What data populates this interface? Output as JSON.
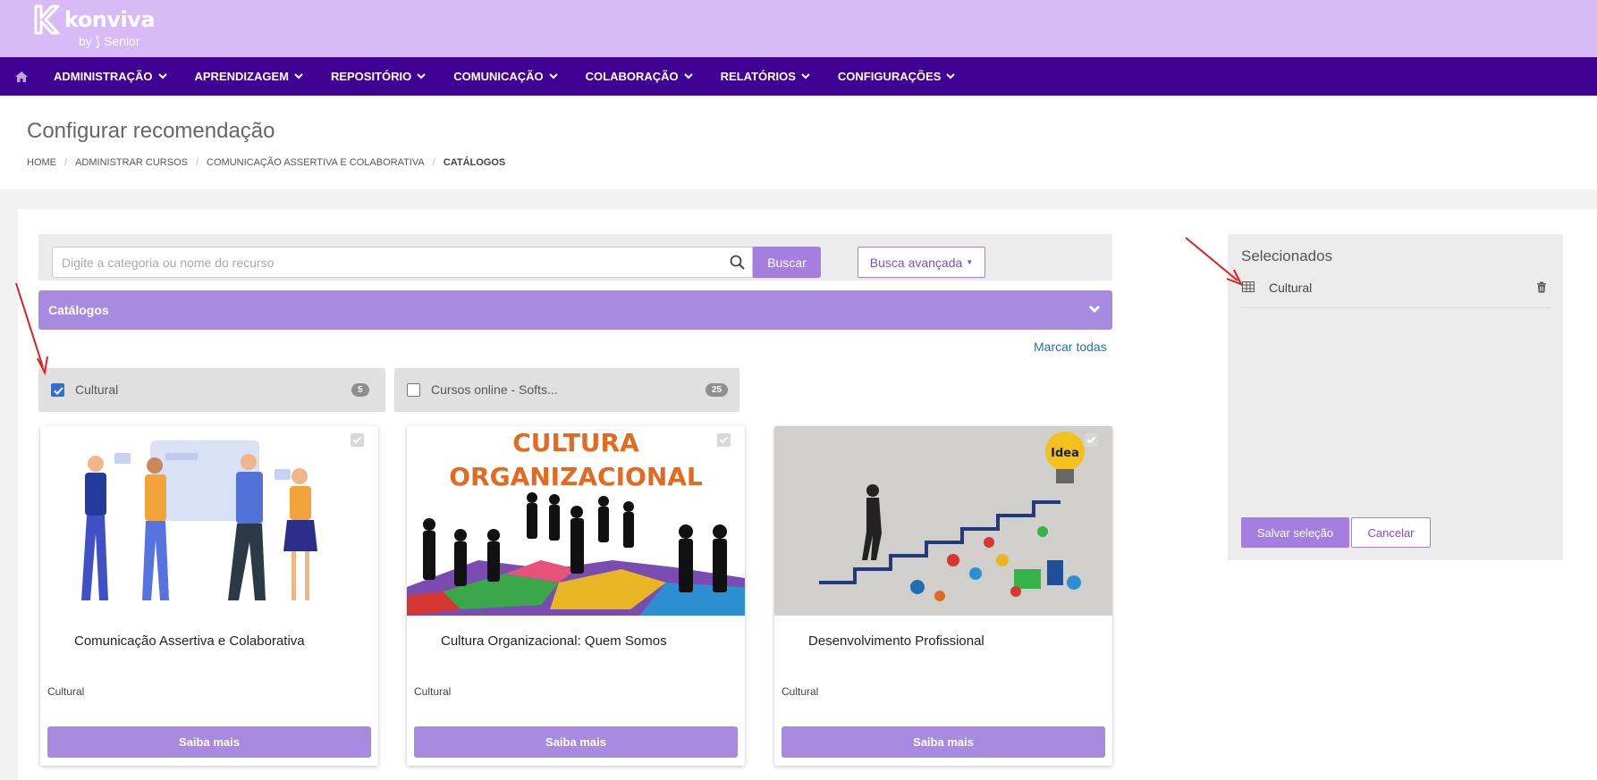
{
  "header": {
    "brand": "konviva",
    "brand_sub": "by ⟆ Senior"
  },
  "nav": {
    "items": [
      {
        "label": "ADMINISTRAÇÃO"
      },
      {
        "label": "APRENDIZAGEM"
      },
      {
        "label": "REPOSITÓRIO"
      },
      {
        "label": "COMUNICAÇÃO"
      },
      {
        "label": "COLABORAÇÃO"
      },
      {
        "label": "RELATÓRIOS"
      },
      {
        "label": "CONFIGURAÇÕES"
      }
    ]
  },
  "page": {
    "title": "Configurar recomendação",
    "breadcrumb": [
      "HOME",
      "ADMINISTRAR CURSOS",
      "COMUNICAÇÃO ASSERTIVA E COLABORATIVA",
      "CATÁLOGOS"
    ]
  },
  "search": {
    "placeholder": "Digite a categoria ou nome do recurso",
    "value": "",
    "button": "Buscar",
    "advanced": "Busca avançada"
  },
  "catalogs": {
    "header": "Catálogos",
    "select_all": "Marcar todas",
    "chips": [
      {
        "name": "Cultural",
        "count": "5",
        "checked": true
      },
      {
        "name": "Cursos online - Softs...",
        "count": "25",
        "checked": false
      }
    ]
  },
  "courses": [
    {
      "title": "Comunicação Assertiva e Colaborativa",
      "category": "Cultural",
      "button": "Saiba mais"
    },
    {
      "title": "Cultura Organizacional: Quem Somos",
      "category": "Cultural",
      "button": "Saiba mais",
      "image_text_1": "CULTURA",
      "image_text_2": "ORGANIZACIONAL"
    },
    {
      "title": "Desenvolvimento Profissional",
      "category": "Cultural",
      "button": "Saiba mais",
      "image_text": "Idea"
    }
  ],
  "selected": {
    "title": "Selecionados",
    "items": [
      {
        "name": "Cultural"
      }
    ],
    "save": "Salvar seleção",
    "cancel": "Cancelar"
  },
  "colors": {
    "topbar": "#d8baf7",
    "navbar": "#3f0192",
    "accent": "#a57fe0"
  }
}
